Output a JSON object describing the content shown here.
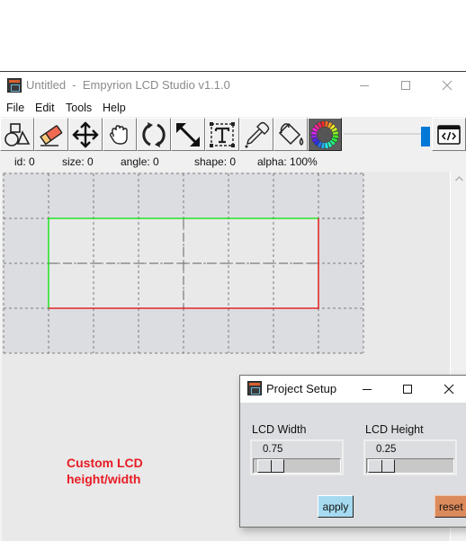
{
  "window": {
    "title": "Untitled  -  Empyrion LCD Studio v1.1.0",
    "controls": {
      "minimize": "minimize",
      "maximize": "maximize",
      "close": "close"
    }
  },
  "menu": [
    "File",
    "Edit",
    "Tools",
    "Help"
  ],
  "toolbar": {
    "tools": [
      {
        "name": "shapes",
        "icon": "shapes-icon"
      },
      {
        "name": "eraser",
        "icon": "eraser-icon"
      },
      {
        "name": "move",
        "icon": "move-arrows-icon"
      },
      {
        "name": "pan",
        "icon": "hand-icon"
      },
      {
        "name": "rotate",
        "icon": "rotate-icon"
      },
      {
        "name": "resize",
        "icon": "resize-arrow-icon"
      },
      {
        "name": "text",
        "icon": "text-box-icon"
      },
      {
        "name": "eyedropper",
        "icon": "eyedropper-icon"
      },
      {
        "name": "fill",
        "icon": "paint-bucket-icon"
      },
      {
        "name": "color",
        "icon": "color-wheel-icon",
        "active": true
      }
    ],
    "alpha_slider_percent": 100,
    "code_button": {
      "icon": "code-window-icon",
      "glyph": "</>"
    }
  },
  "status": {
    "id": "id: 0",
    "size": "size: 0",
    "angle": "angle: 0",
    "shape": "shape: 0",
    "alpha": "alpha: 100%"
  },
  "canvas": {
    "grid_cols": 8,
    "grid_rows": 4,
    "lcd_width": 0.75,
    "lcd_height": 0.25,
    "colors": {
      "outside": "#dcdde0",
      "lcd_area": "#e9e9e9",
      "grid_line": "#7a7a7a",
      "lcd_border_top_left": "#00e600",
      "lcd_border_bottom_right": "#e60000"
    }
  },
  "annotation": {
    "line1": "Custom LCD",
    "line2": "height/width",
    "color": "#e81c24"
  },
  "project_setup": {
    "title": "Project Setup",
    "width_label": "LCD Width",
    "width_value": "0.75",
    "height_label": "LCD Height",
    "height_value": "0.25",
    "apply_label": "apply",
    "reset_label": "reset",
    "apply_color": "#a6daf0",
    "reset_color": "#db8a5b"
  }
}
